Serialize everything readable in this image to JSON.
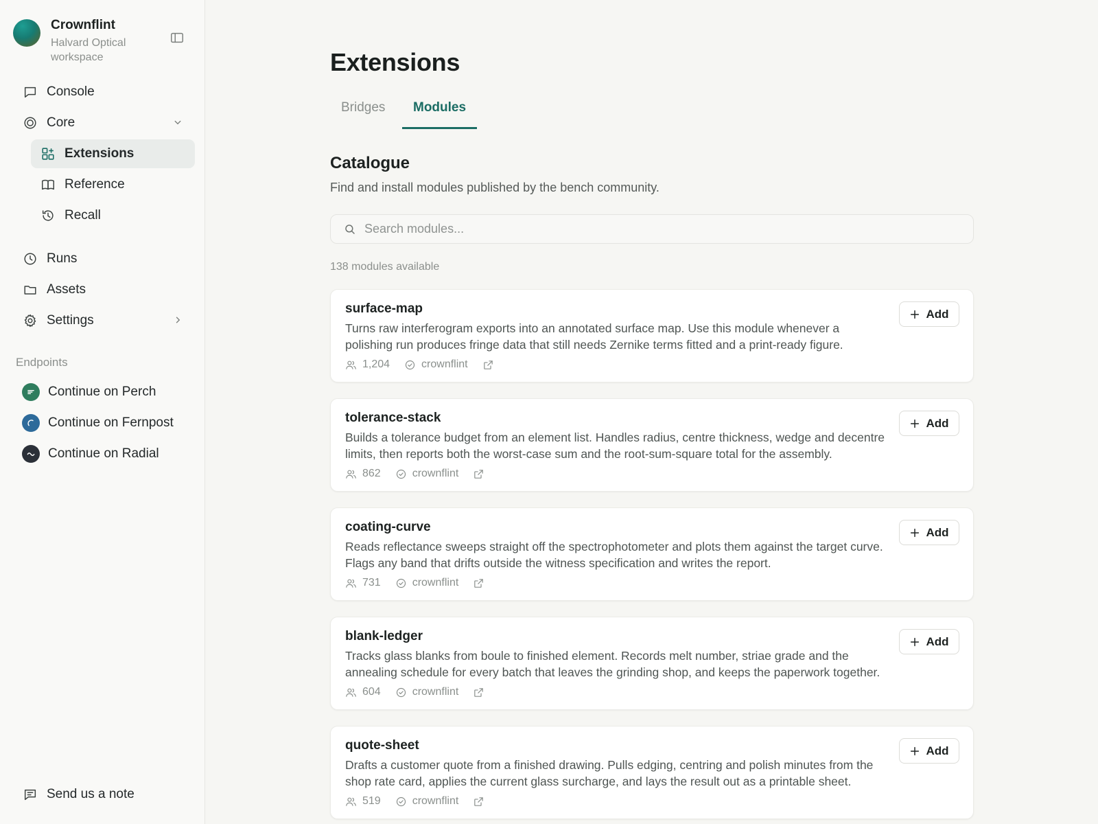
{
  "workspace": {
    "name": "Crownflint",
    "subtitle": "Halvard Optical workspace"
  },
  "sidebar": {
    "items": [
      {
        "label": "Console",
        "icon": "chat-bubble-icon"
      },
      {
        "label": "Core",
        "icon": "target-icon",
        "expanded": true
      },
      {
        "label": "Extensions",
        "icon": "extensions-icon",
        "active": true
      },
      {
        "label": "Reference",
        "icon": "book-icon"
      },
      {
        "label": "Recall",
        "icon": "history-icon"
      },
      {
        "label": "Runs",
        "icon": "clock-icon"
      },
      {
        "label": "Assets",
        "icon": "folder-icon"
      },
      {
        "label": "Settings",
        "icon": "gear-icon"
      }
    ],
    "endpoints_label": "Endpoints",
    "endpoints": [
      {
        "label": "Continue on Perch",
        "color": "#2f7d5e"
      },
      {
        "label": "Continue on Fernpost",
        "color": "#2d6a9a"
      },
      {
        "label": "Continue on Radial",
        "color": "#2b3038"
      }
    ],
    "footer_label": "Send us a note"
  },
  "main": {
    "title": "Extensions",
    "tabs": [
      {
        "label": "Bridges",
        "active": false
      },
      {
        "label": "Modules",
        "active": true
      }
    ],
    "catalogue_title": "Catalogue",
    "catalogue_subtitle": "Find and install modules published by the bench community.",
    "search_placeholder": "Search modules...",
    "count_text": "138 modules available",
    "add_label": "Add",
    "modules": [
      {
        "name": "surface-map",
        "description": "Turns raw interferogram exports into an annotated surface map. Use this module whenever a polishing run produces fringe data that still needs Zernike terms fitted and a print-ready figure.",
        "users": "1,204",
        "publisher": "crownflint"
      },
      {
        "name": "tolerance-stack",
        "description": "Builds a tolerance budget from an element list. Handles radius, centre thickness, wedge and decentre limits, then reports both the worst-case sum and the root-sum-square total for the assembly.",
        "users": "862",
        "publisher": "crownflint"
      },
      {
        "name": "coating-curve",
        "description": "Reads reflectance sweeps straight off the spectrophotometer and plots them against the target curve. Flags any band that drifts outside the witness specification and writes the report.",
        "users": "731",
        "publisher": "crownflint"
      },
      {
        "name": "blank-ledger",
        "description": "Tracks glass blanks from boule to finished element. Records melt number, striae grade and the annealing schedule for every batch that leaves the grinding shop, and keeps the paperwork together.",
        "users": "604",
        "publisher": "crownflint"
      },
      {
        "name": "quote-sheet",
        "description": "Drafts a customer quote from a finished drawing. Pulls edging, centring and polish minutes from the shop rate card, applies the current glass surcharge, and lays the result out as a printable sheet.",
        "users": "519",
        "publisher": "crownflint"
      }
    ]
  }
}
